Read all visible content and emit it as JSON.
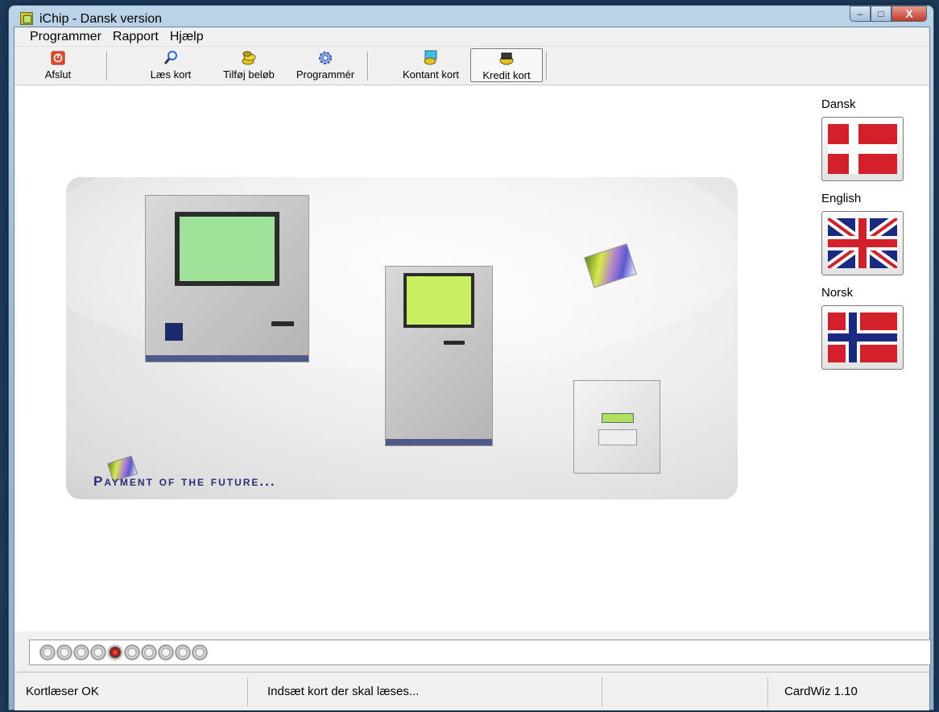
{
  "window": {
    "title": "iChip  -  Dansk version",
    "min_glyph": "–",
    "max_glyph": "□",
    "close_glyph": "X"
  },
  "menu": [
    "Programmer",
    "Rapport",
    "Hjælp"
  ],
  "toolbar": {
    "exit_label": "Afslut",
    "read_card_label": "Læs kort",
    "add_amount_label": "Tilføj beløb",
    "program_label": "Programmér",
    "cash_card_label": "Kontant kort",
    "credit_card_label": "Kredit kort"
  },
  "banner": {
    "slogan": "Payment of the future..."
  },
  "languages": [
    {
      "label": "Dansk",
      "flag": "dk-flag-icon"
    },
    {
      "label": "English",
      "flag": "uk-flag-icon"
    },
    {
      "label": "Norsk",
      "flag": "no-flag-icon"
    }
  ],
  "progress": {
    "dot_count": 10,
    "active_index": 4
  },
  "status": {
    "reader": "Kortlæser OK",
    "message": "Indsæt kort der skal læses...",
    "empty": "",
    "version": "CardWiz 1.10"
  },
  "colors": {
    "accent_red": "#d4202a",
    "slogan_blue": "#2a2e78",
    "screen_green": "#9fe29a"
  }
}
